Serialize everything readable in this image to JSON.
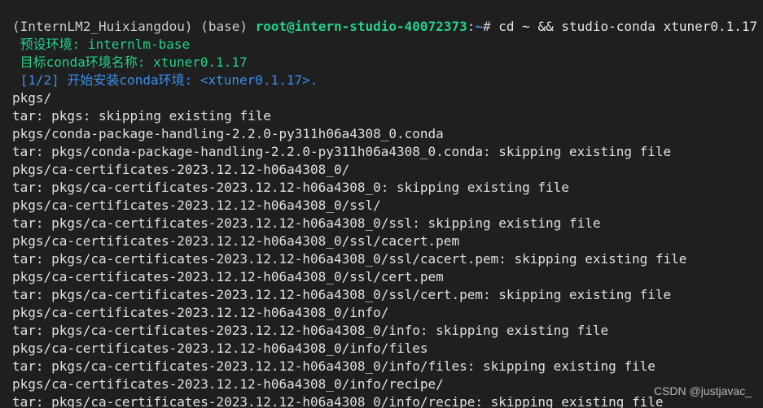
{
  "prompt": {
    "env": "(InternLM2_Huixiangdou) (base)",
    "user_host": "root@intern-studio-40072373",
    "separator": ":",
    "cwd": "~",
    "symbol": "#",
    "command": "cd ~ && studio-conda xtuner0.1.17"
  },
  "colors": {
    "background": "#1f1f1f",
    "prompt_user": "#23d18b",
    "prompt_path": "#3b8eea",
    "info_green": "#23d18b",
    "info_blue": "#3b8eea",
    "output_text": "#e0e0e0"
  },
  "info_lines": [
    " 预设环境: internlm-base",
    " 目标conda环境名称: xtuner0.1.17",
    " [1/2] 开始安装conda环境: <xtuner0.1.17>."
  ],
  "output_lines": [
    "pkgs/",
    "tar: pkgs: skipping existing file",
    "pkgs/conda-package-handling-2.2.0-py311h06a4308_0.conda",
    "tar: pkgs/conda-package-handling-2.2.0-py311h06a4308_0.conda: skipping existing file",
    "pkgs/ca-certificates-2023.12.12-h06a4308_0/",
    "tar: pkgs/ca-certificates-2023.12.12-h06a4308_0: skipping existing file",
    "pkgs/ca-certificates-2023.12.12-h06a4308_0/ssl/",
    "tar: pkgs/ca-certificates-2023.12.12-h06a4308_0/ssl: skipping existing file",
    "pkgs/ca-certificates-2023.12.12-h06a4308_0/ssl/cacert.pem",
    "tar: pkgs/ca-certificates-2023.12.12-h06a4308_0/ssl/cacert.pem: skipping existing file",
    "pkgs/ca-certificates-2023.12.12-h06a4308_0/ssl/cert.pem",
    "tar: pkgs/ca-certificates-2023.12.12-h06a4308_0/ssl/cert.pem: skipping existing file",
    "pkgs/ca-certificates-2023.12.12-h06a4308_0/info/",
    "tar: pkgs/ca-certificates-2023.12.12-h06a4308_0/info: skipping existing file",
    "pkgs/ca-certificates-2023.12.12-h06a4308_0/info/files",
    "tar: pkgs/ca-certificates-2023.12.12-h06a4308_0/info/files: skipping existing file",
    "pkgs/ca-certificates-2023.12.12-h06a4308_0/info/recipe/",
    "tar: pkgs/ca-certificates-2023.12.12-h06a4308_0/info/recipe: skipping existing file"
  ],
  "watermark": "CSDN @justjavac_"
}
